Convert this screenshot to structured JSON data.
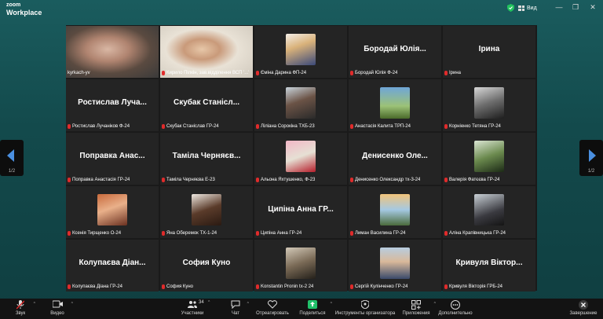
{
  "app": {
    "brand_top": "zoom",
    "brand_bottom": "Workplace",
    "view_label": "Вид",
    "win_minimize": "—",
    "win_restore": "❐",
    "win_close": "✕",
    "page_indicator": "1/2"
  },
  "colors": {
    "speaker_border": "#21c06a",
    "muted_mic": "#e02b2b",
    "accent_arrow": "#4a8fe0"
  },
  "tiles": [
    {
      "label": "kyrkach-yv",
      "video": true
    },
    {
      "label": "Кирило Пілкін, зав.відділення ВСП '...'",
      "video": true
    },
    {
      "label": "Єміна Дарина ФП-24",
      "photo": true
    },
    {
      "name": "Бородай Юлія...",
      "label": "Бородай Юлія Ф-24"
    },
    {
      "name": "Ірина",
      "label": "Ірина"
    },
    {
      "name": "Ростислав Луча...",
      "label": "Ростислав Лучаніков Ф-24"
    },
    {
      "name": "Скубак Станісл...",
      "label": "Скубак Станіслав ГР-24"
    },
    {
      "label": "Ліліана Сорокіна ТХБ-23",
      "photo": true
    },
    {
      "label": "Анастасія Калита ТРП-24",
      "photo": true
    },
    {
      "label": "Корніенко Тетяна ГР-24",
      "photo": true
    },
    {
      "name": "Поправка Анас...",
      "label": "Поправка Анастасія ГР-24"
    },
    {
      "name": "Таміла Черняєв...",
      "label": "Таміла Черняєва Е-23"
    },
    {
      "label": "Альона Яхтушенко, Ф-23",
      "photo": true
    },
    {
      "name": "Денисенко Оле...",
      "label": "Денисенко Олександр тх-3-24"
    },
    {
      "label": "Валерія Фатєєва ГР-24",
      "photo": true
    },
    {
      "label": "Ксенія Тирщенко О-24",
      "photo": true
    },
    {
      "label": "Яна Оберемок ТХ-1-24",
      "photo": true
    },
    {
      "name": "Ципіна Анна ГР...",
      "label": "Ципіна Анна ГР-24"
    },
    {
      "label": "Лиман Василина ГР-24",
      "photo": true
    },
    {
      "label": "Аліна Крапівницька ГР-24",
      "photo": true
    },
    {
      "name": "Колупаєва Діан...",
      "label": "Колупаєва Діана ГР-24"
    },
    {
      "name": "София Куно",
      "label": "София Куно"
    },
    {
      "label": "Konstantin Pronin tx-2 24",
      "photo": true
    },
    {
      "label": "Сергій Кулінченко ГР-24",
      "photo": true
    },
    {
      "name": "Кривуля Віктор...",
      "label": "Кривуля Вікторія ГРБ-24"
    }
  ],
  "toolbar": {
    "audio": "Звук",
    "video": "Видео",
    "participants": "Участники",
    "participants_count": "34",
    "chat": "Чат",
    "react": "Отреагировать",
    "share": "Поделиться",
    "host_tools": "Инструменты организатора",
    "apps": "Приложения",
    "more": "Дополнительно",
    "end": "Завершение"
  }
}
